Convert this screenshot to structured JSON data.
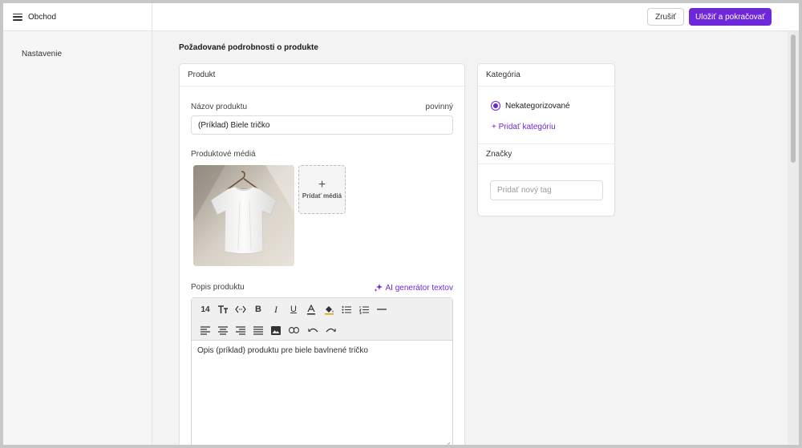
{
  "sidebar": {
    "title": "Obchod",
    "items": [
      {
        "label": "Nastavenie"
      }
    ]
  },
  "topbar": {
    "cancel_label": "Zrušiť",
    "save_label": "Uložiť a pokračovať"
  },
  "main": {
    "section_title": "Požadované podrobnosti o produkte",
    "product_card": {
      "title": "Produkt",
      "name_label": "Názov produktu",
      "required_label": "povinný",
      "name_value": "(Príklad) Biele tričko",
      "media_label": "Produktové médiá",
      "add_media_label": "Pridať médiá",
      "description_label": "Popis produktu",
      "ai_generator_label": "AI generátor textov",
      "toolbar": {
        "font_size": "14"
      },
      "description_value": "Opis (príklad) produktu pre biele bavlnené tričko"
    },
    "category_card": {
      "title": "Kategória",
      "selected_category": "Nekategorizované",
      "add_category_label": "+ Pridať kategóriu",
      "tags_title": "Značky",
      "tag_placeholder": "Pridať nový tag"
    }
  },
  "colors": {
    "accent": "#6d28d9"
  }
}
